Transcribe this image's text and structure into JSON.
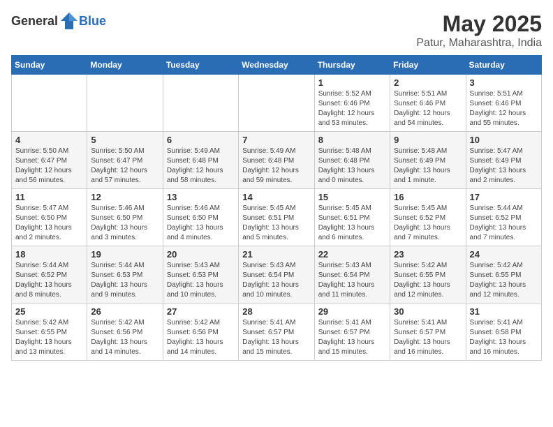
{
  "logo": {
    "general": "General",
    "blue": "Blue"
  },
  "title": "May 2025",
  "location": "Patur, Maharashtra, India",
  "weekdays": [
    "Sunday",
    "Monday",
    "Tuesday",
    "Wednesday",
    "Thursday",
    "Friday",
    "Saturday"
  ],
  "weeks": [
    [
      {
        "day": "",
        "info": ""
      },
      {
        "day": "",
        "info": ""
      },
      {
        "day": "",
        "info": ""
      },
      {
        "day": "",
        "info": ""
      },
      {
        "day": "1",
        "info": "Sunrise: 5:52 AM\nSunset: 6:46 PM\nDaylight: 12 hours\nand 53 minutes."
      },
      {
        "day": "2",
        "info": "Sunrise: 5:51 AM\nSunset: 6:46 PM\nDaylight: 12 hours\nand 54 minutes."
      },
      {
        "day": "3",
        "info": "Sunrise: 5:51 AM\nSunset: 6:46 PM\nDaylight: 12 hours\nand 55 minutes."
      }
    ],
    [
      {
        "day": "4",
        "info": "Sunrise: 5:50 AM\nSunset: 6:47 PM\nDaylight: 12 hours\nand 56 minutes."
      },
      {
        "day": "5",
        "info": "Sunrise: 5:50 AM\nSunset: 6:47 PM\nDaylight: 12 hours\nand 57 minutes."
      },
      {
        "day": "6",
        "info": "Sunrise: 5:49 AM\nSunset: 6:48 PM\nDaylight: 12 hours\nand 58 minutes."
      },
      {
        "day": "7",
        "info": "Sunrise: 5:49 AM\nSunset: 6:48 PM\nDaylight: 12 hours\nand 59 minutes."
      },
      {
        "day": "8",
        "info": "Sunrise: 5:48 AM\nSunset: 6:48 PM\nDaylight: 13 hours\nand 0 minutes."
      },
      {
        "day": "9",
        "info": "Sunrise: 5:48 AM\nSunset: 6:49 PM\nDaylight: 13 hours\nand 1 minute."
      },
      {
        "day": "10",
        "info": "Sunrise: 5:47 AM\nSunset: 6:49 PM\nDaylight: 13 hours\nand 2 minutes."
      }
    ],
    [
      {
        "day": "11",
        "info": "Sunrise: 5:47 AM\nSunset: 6:50 PM\nDaylight: 13 hours\nand 2 minutes."
      },
      {
        "day": "12",
        "info": "Sunrise: 5:46 AM\nSunset: 6:50 PM\nDaylight: 13 hours\nand 3 minutes."
      },
      {
        "day": "13",
        "info": "Sunrise: 5:46 AM\nSunset: 6:50 PM\nDaylight: 13 hours\nand 4 minutes."
      },
      {
        "day": "14",
        "info": "Sunrise: 5:45 AM\nSunset: 6:51 PM\nDaylight: 13 hours\nand 5 minutes."
      },
      {
        "day": "15",
        "info": "Sunrise: 5:45 AM\nSunset: 6:51 PM\nDaylight: 13 hours\nand 6 minutes."
      },
      {
        "day": "16",
        "info": "Sunrise: 5:45 AM\nSunset: 6:52 PM\nDaylight: 13 hours\nand 7 minutes."
      },
      {
        "day": "17",
        "info": "Sunrise: 5:44 AM\nSunset: 6:52 PM\nDaylight: 13 hours\nand 7 minutes."
      }
    ],
    [
      {
        "day": "18",
        "info": "Sunrise: 5:44 AM\nSunset: 6:52 PM\nDaylight: 13 hours\nand 8 minutes."
      },
      {
        "day": "19",
        "info": "Sunrise: 5:44 AM\nSunset: 6:53 PM\nDaylight: 13 hours\nand 9 minutes."
      },
      {
        "day": "20",
        "info": "Sunrise: 5:43 AM\nSunset: 6:53 PM\nDaylight: 13 hours\nand 10 minutes."
      },
      {
        "day": "21",
        "info": "Sunrise: 5:43 AM\nSunset: 6:54 PM\nDaylight: 13 hours\nand 10 minutes."
      },
      {
        "day": "22",
        "info": "Sunrise: 5:43 AM\nSunset: 6:54 PM\nDaylight: 13 hours\nand 11 minutes."
      },
      {
        "day": "23",
        "info": "Sunrise: 5:42 AM\nSunset: 6:55 PM\nDaylight: 13 hours\nand 12 minutes."
      },
      {
        "day": "24",
        "info": "Sunrise: 5:42 AM\nSunset: 6:55 PM\nDaylight: 13 hours\nand 12 minutes."
      }
    ],
    [
      {
        "day": "25",
        "info": "Sunrise: 5:42 AM\nSunset: 6:55 PM\nDaylight: 13 hours\nand 13 minutes."
      },
      {
        "day": "26",
        "info": "Sunrise: 5:42 AM\nSunset: 6:56 PM\nDaylight: 13 hours\nand 14 minutes."
      },
      {
        "day": "27",
        "info": "Sunrise: 5:42 AM\nSunset: 6:56 PM\nDaylight: 13 hours\nand 14 minutes."
      },
      {
        "day": "28",
        "info": "Sunrise: 5:41 AM\nSunset: 6:57 PM\nDaylight: 13 hours\nand 15 minutes."
      },
      {
        "day": "29",
        "info": "Sunrise: 5:41 AM\nSunset: 6:57 PM\nDaylight: 13 hours\nand 15 minutes."
      },
      {
        "day": "30",
        "info": "Sunrise: 5:41 AM\nSunset: 6:57 PM\nDaylight: 13 hours\nand 16 minutes."
      },
      {
        "day": "31",
        "info": "Sunrise: 5:41 AM\nSunset: 6:58 PM\nDaylight: 13 hours\nand 16 minutes."
      }
    ]
  ]
}
